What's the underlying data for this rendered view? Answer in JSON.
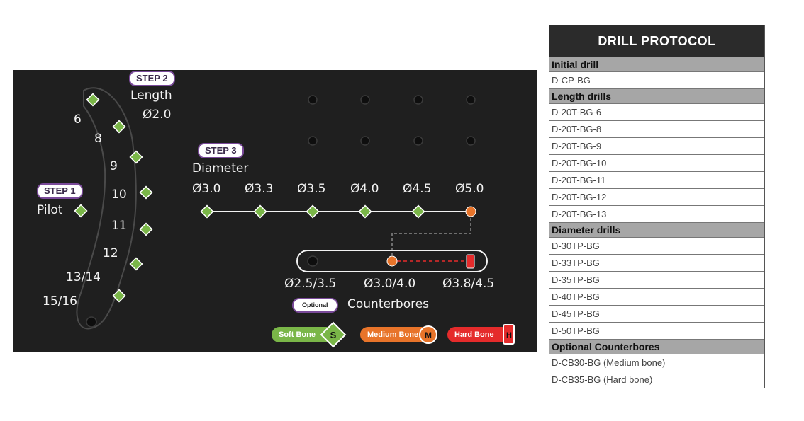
{
  "tray": {
    "step1": {
      "badge": "STEP 1",
      "title": "Pilot"
    },
    "step2": {
      "badge": "STEP 2",
      "title": "Length",
      "diameter": "Ø2.0",
      "lengths": [
        "6",
        "8",
        "9",
        "10",
        "11",
        "12",
        "13/14",
        "15/16"
      ]
    },
    "step3": {
      "badge": "STEP 3",
      "title": "Diameter",
      "diameters": [
        "Ø3.0",
        "Ø3.3",
        "Ø3.5",
        "Ø4.0",
        "Ø4.5",
        "Ø5.0"
      ]
    },
    "counterbores": {
      "badge": "Optional",
      "title": "Counterbores",
      "sizes": [
        "Ø2.5/3.5",
        "Ø3.0/4.0",
        "Ø3.8/4.5"
      ]
    },
    "legend": [
      {
        "label": "Soft Bone",
        "letter": "S",
        "color": "#7ab648"
      },
      {
        "label": "Medium Bone",
        "letter": "M",
        "color": "#e8742a"
      },
      {
        "label": "Hard Bone",
        "letter": "H",
        "color": "#e52b2b"
      }
    ]
  },
  "protocol": {
    "title": "DRILL PROTOCOL",
    "sections": [
      {
        "name": "Initial drill",
        "items": [
          "D-CP-BG"
        ]
      },
      {
        "name": "Length drills",
        "items": [
          "D-20T-BG-6",
          "D-20T-BG-8",
          "D-20T-BG-9",
          "D-20T-BG-10",
          "D-20T-BG-11",
          "D-20T-BG-12",
          "D-20T-BG-13"
        ]
      },
      {
        "name": "Diameter drills",
        "items": [
          "D-30TP-BG",
          "D-33TP-BG",
          "D-35TP-BG",
          "D-40TP-BG",
          "D-45TP-BG",
          "D-50TP-BG"
        ]
      },
      {
        "name": "Optional Counterbores",
        "items": [
          "D-CB30-BG (Medium bone)",
          "D-CB35-BG (Hard bone)"
        ]
      }
    ]
  }
}
